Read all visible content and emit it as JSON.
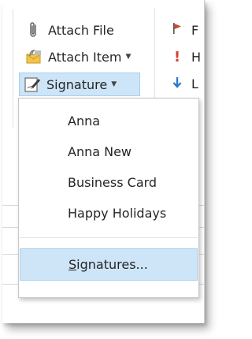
{
  "ribbon": {
    "attach_file": {
      "label": "Attach File",
      "icon": "paperclip-icon"
    },
    "attach_item": {
      "label": "Attach Item",
      "icon": "envelope-icon",
      "has_dropdown": true
    },
    "signature": {
      "label": "Signature",
      "icon": "signature-pen-icon",
      "has_dropdown": true,
      "state": "pressed"
    },
    "right_column": [
      {
        "icon": "flag-icon",
        "letter": "F",
        "color": "#d13438"
      },
      {
        "icon": "high-importance-icon",
        "letter": "H",
        "color": "#d13438"
      },
      {
        "icon": "low-importance-icon",
        "letter": "L",
        "color": "#2b79d0"
      }
    ]
  },
  "signature_menu": {
    "items": [
      {
        "label": "Anna"
      },
      {
        "label": "Anna New"
      },
      {
        "label": "Business Card"
      },
      {
        "label": "Happy Holidays"
      }
    ],
    "manage": {
      "label": "Signatures...",
      "mnemonic": "S",
      "rest": "ignatures...",
      "highlighted": true
    }
  },
  "colors": {
    "highlight": "#cde5f7",
    "highlight_border": "#a8cfee",
    "text": "#262626"
  }
}
